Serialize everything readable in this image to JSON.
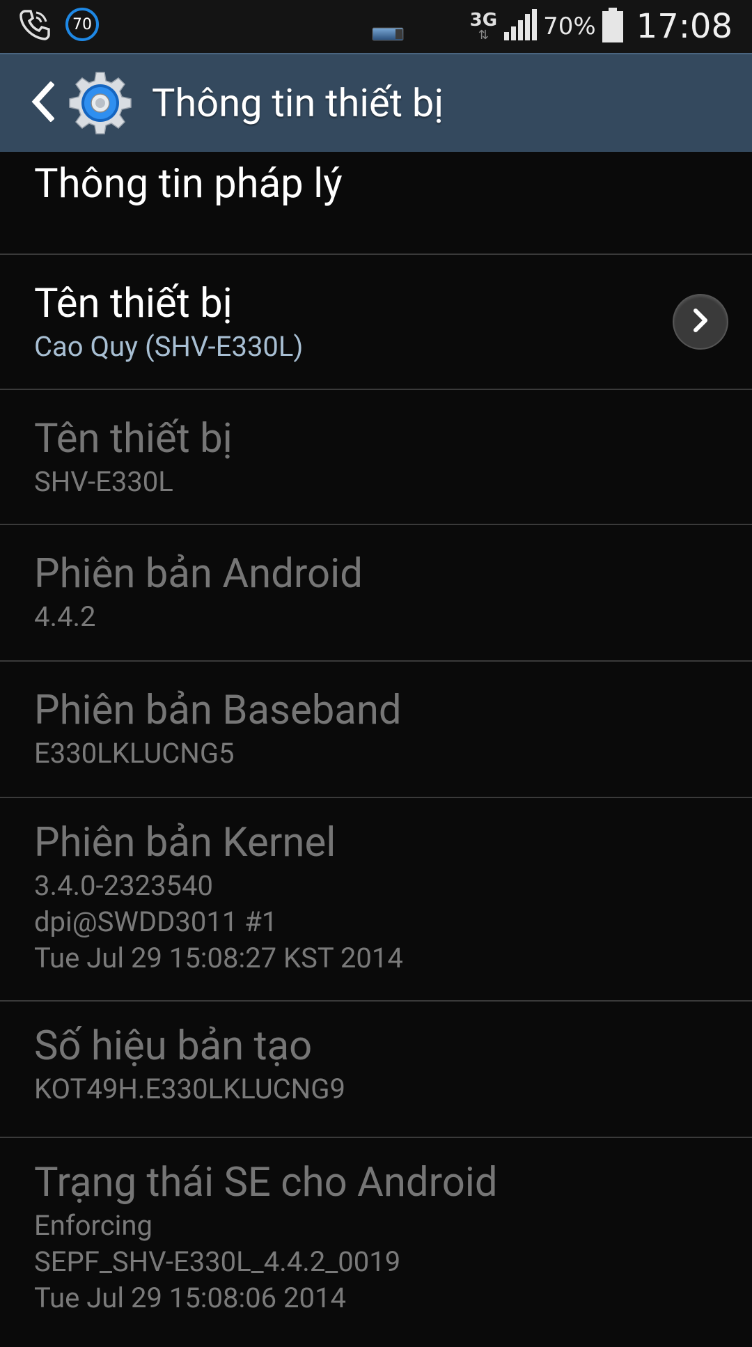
{
  "status_bar": {
    "badge_value": "70",
    "network_type": "3G",
    "network_arrows": "⇅",
    "battery_percent": "70%",
    "time": "17:08",
    "icons": [
      "phone-call-icon",
      "notification-badge-icon",
      "battery-notification-icon",
      "network-type-icon",
      "signal-strength-icon",
      "battery-icon"
    ]
  },
  "action_bar": {
    "title": "Thông tin thiết bị",
    "back_icon": "back-chevron-icon",
    "app_icon": "settings-gear-icon",
    "accent_color": "#1e88e5",
    "background_color": "#34495e"
  },
  "list": {
    "items": [
      {
        "title": "Thông tin pháp lý"
      },
      {
        "title": "Tên thiết bị",
        "subtitle": "Cao Quy (SHV-E330L)",
        "action_icon": "chevron-right-icon"
      },
      {
        "title": "Tên thiết bị",
        "subtitle": "SHV-E330L"
      },
      {
        "title": "Phiên bản Android",
        "subtitle": "4.4.2"
      },
      {
        "title": "Phiên bản Baseband",
        "subtitle": "E330LKLUCNG5"
      },
      {
        "title": "Phiên bản Kernel",
        "lines": [
          "3.4.0-2323540",
          "dpi@SWDD3011 #1",
          "Tue Jul 29 15:08:27 KST 2014"
        ]
      },
      {
        "title": "Số hiệu bản tạo",
        "subtitle": "KOT49H.E330LKLUCNG9"
      },
      {
        "title": "Trạng thái SE cho Android",
        "lines": [
          "Enforcing",
          "SEPF_SHV-E330L_4.4.2_0019",
          "Tue Jul 29 15:08:06 2014"
        ]
      }
    ]
  }
}
